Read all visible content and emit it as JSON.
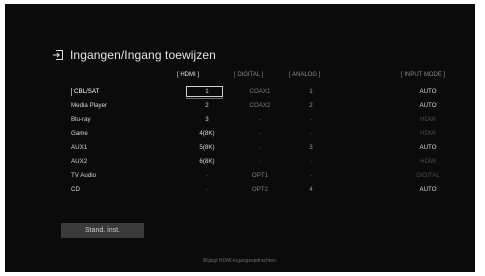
{
  "screen": {
    "title": "Ingangen/Ingang toewijzen",
    "icon": "input-icon"
  },
  "columns": {
    "hdmi": "[   HDMI   ]",
    "digital": "[   DIGITAL   ]",
    "analog": "[   ANALOG   ]",
    "input_mode": "[ INPUT MODE ]"
  },
  "rows": [
    {
      "name": "CBL/SAT",
      "hdmi": "1",
      "digital": "COAX1",
      "analog": "1",
      "mode": "AUTO"
    },
    {
      "name": "Media Player",
      "hdmi": "2",
      "digital": "COAX2",
      "analog": "2",
      "mode": "AUTO"
    },
    {
      "name": "Blu-ray",
      "hdmi": "3",
      "digital": "-",
      "analog": "-",
      "mode": "HDMI"
    },
    {
      "name": "Game",
      "hdmi": "4(8K)",
      "digital": "-",
      "analog": "-",
      "mode": "HDMI"
    },
    {
      "name": "AUX1",
      "hdmi": "5(8K)",
      "digital": "-",
      "analog": "3",
      "mode": "AUTO"
    },
    {
      "name": "AUX2",
      "hdmi": "6(8K)",
      "digital": "-",
      "analog": "-",
      "mode": "HDMI"
    },
    {
      "name": "TV Audio",
      "hdmi": "-",
      "digital": "OPT1",
      "analog": "-",
      "mode": "DIGITAL"
    },
    {
      "name": "CD",
      "hdmi": "-",
      "digital": "OPT2",
      "analog": "4",
      "mode": "AUTO"
    }
  ],
  "reset_button": "Stand. inst.",
  "hint": "Wijzigt HDMI-ingangsopdrachten.",
  "colors": {
    "background": "#0b0b0c",
    "text": "#d6d6d6",
    "button": "#3a3a3a"
  }
}
